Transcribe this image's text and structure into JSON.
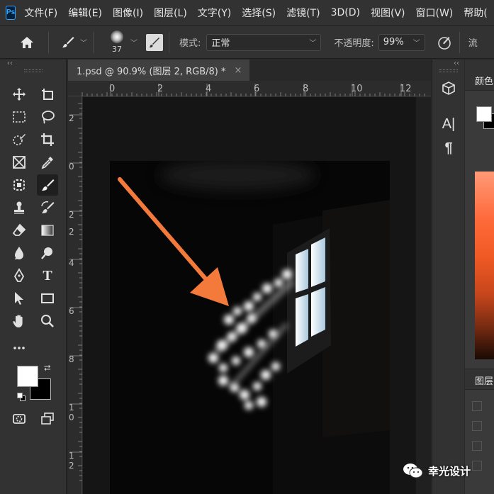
{
  "app": {
    "logo_text": "Ps"
  },
  "menu": {
    "items": [
      {
        "label": "文件(F)"
      },
      {
        "label": "编辑(E)"
      },
      {
        "label": "图像(I)"
      },
      {
        "label": "图层(L)"
      },
      {
        "label": "文字(Y)"
      },
      {
        "label": "选择(S)"
      },
      {
        "label": "滤镜(T)"
      },
      {
        "label": "3D(D)"
      },
      {
        "label": "视图(V)"
      },
      {
        "label": "窗口(W)"
      },
      {
        "label": "帮助("
      }
    ]
  },
  "options": {
    "brush_size": "37",
    "mode_label": "模式:",
    "mode_value": "正常",
    "opacity_label": "不透明度:",
    "opacity_value": "99%",
    "flow_label": "流"
  },
  "document": {
    "tab_title": "1.psd @ 90.9% (图层 2, RGB/8) *",
    "close_glyph": "×"
  },
  "rulers": {
    "horizontal": [
      "0",
      "2",
      "4",
      "6",
      "8",
      "10",
      "12"
    ],
    "vertical": [
      "2",
      "0",
      "2",
      "2",
      "4",
      "6",
      "8",
      "1\n0",
      "1\n2"
    ]
  },
  "panels": {
    "color_title": "颜色",
    "layers_title": "图层"
  },
  "colors": {
    "foreground": "#ffffff",
    "background": "#000000",
    "arrow": "#f47a3b"
  },
  "watermark": {
    "text": "幸光设计"
  }
}
